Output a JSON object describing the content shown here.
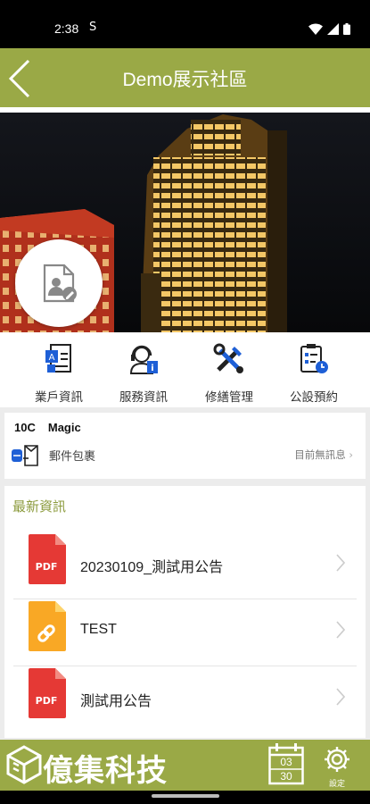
{
  "status_bar": {
    "time": "2:38"
  },
  "header": {
    "title": "Demo展示社區"
  },
  "menu": [
    {
      "label": "業戶資訊",
      "icon": "resident-info-icon"
    },
    {
      "label": "服務資訊",
      "icon": "service-info-icon"
    },
    {
      "label": "修繕管理",
      "icon": "repair-tools-icon"
    },
    {
      "label": "公設預約",
      "icon": "facility-booking-icon"
    }
  ],
  "mail": {
    "unit": "10C",
    "name": "Magic",
    "label": "郵件包裹",
    "status": "目前無訊息"
  },
  "news": {
    "heading": "最新資訊",
    "items": [
      {
        "title": "20230109_測試用公告",
        "type": "PDF",
        "color": "#e53935"
      },
      {
        "title": "TEST",
        "type": "link",
        "color": "#f9a825"
      },
      {
        "title": "測試用公告",
        "type": "PDF",
        "color": "#e53935"
      }
    ]
  },
  "footer": {
    "brand": "億集科技",
    "calendar_top": "03",
    "calendar_bottom": "30",
    "settings_label": "設定"
  },
  "colors": {
    "accent": "#9aa946",
    "news_heading": "#8c9b3e"
  }
}
